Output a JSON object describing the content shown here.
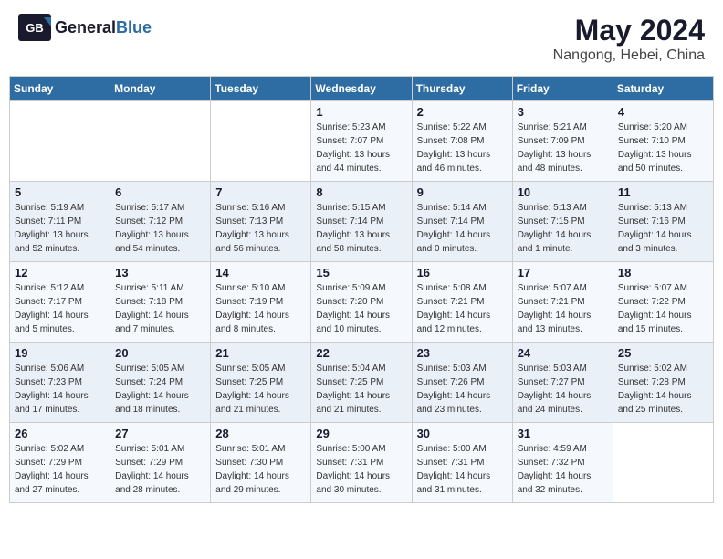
{
  "header": {
    "logo_general": "General",
    "logo_blue": "Blue",
    "month_year": "May 2024",
    "location": "Nangong, Hebei, China"
  },
  "weekdays": [
    "Sunday",
    "Monday",
    "Tuesday",
    "Wednesday",
    "Thursday",
    "Friday",
    "Saturday"
  ],
  "weeks": [
    [
      {
        "day": "",
        "sunrise": "",
        "sunset": "",
        "daylight": ""
      },
      {
        "day": "",
        "sunrise": "",
        "sunset": "",
        "daylight": ""
      },
      {
        "day": "",
        "sunrise": "",
        "sunset": "",
        "daylight": ""
      },
      {
        "day": "1",
        "sunrise": "Sunrise: 5:23 AM",
        "sunset": "Sunset: 7:07 PM",
        "daylight": "Daylight: 13 hours and 44 minutes."
      },
      {
        "day": "2",
        "sunrise": "Sunrise: 5:22 AM",
        "sunset": "Sunset: 7:08 PM",
        "daylight": "Daylight: 13 hours and 46 minutes."
      },
      {
        "day": "3",
        "sunrise": "Sunrise: 5:21 AM",
        "sunset": "Sunset: 7:09 PM",
        "daylight": "Daylight: 13 hours and 48 minutes."
      },
      {
        "day": "4",
        "sunrise": "Sunrise: 5:20 AM",
        "sunset": "Sunset: 7:10 PM",
        "daylight": "Daylight: 13 hours and 50 minutes."
      }
    ],
    [
      {
        "day": "5",
        "sunrise": "Sunrise: 5:19 AM",
        "sunset": "Sunset: 7:11 PM",
        "daylight": "Daylight: 13 hours and 52 minutes."
      },
      {
        "day": "6",
        "sunrise": "Sunrise: 5:17 AM",
        "sunset": "Sunset: 7:12 PM",
        "daylight": "Daylight: 13 hours and 54 minutes."
      },
      {
        "day": "7",
        "sunrise": "Sunrise: 5:16 AM",
        "sunset": "Sunset: 7:13 PM",
        "daylight": "Daylight: 13 hours and 56 minutes."
      },
      {
        "day": "8",
        "sunrise": "Sunrise: 5:15 AM",
        "sunset": "Sunset: 7:14 PM",
        "daylight": "Daylight: 13 hours and 58 minutes."
      },
      {
        "day": "9",
        "sunrise": "Sunrise: 5:14 AM",
        "sunset": "Sunset: 7:14 PM",
        "daylight": "Daylight: 14 hours and 0 minutes."
      },
      {
        "day": "10",
        "sunrise": "Sunrise: 5:13 AM",
        "sunset": "Sunset: 7:15 PM",
        "daylight": "Daylight: 14 hours and 1 minute."
      },
      {
        "day": "11",
        "sunrise": "Sunrise: 5:13 AM",
        "sunset": "Sunset: 7:16 PM",
        "daylight": "Daylight: 14 hours and 3 minutes."
      }
    ],
    [
      {
        "day": "12",
        "sunrise": "Sunrise: 5:12 AM",
        "sunset": "Sunset: 7:17 PM",
        "daylight": "Daylight: 14 hours and 5 minutes."
      },
      {
        "day": "13",
        "sunrise": "Sunrise: 5:11 AM",
        "sunset": "Sunset: 7:18 PM",
        "daylight": "Daylight: 14 hours and 7 minutes."
      },
      {
        "day": "14",
        "sunrise": "Sunrise: 5:10 AM",
        "sunset": "Sunset: 7:19 PM",
        "daylight": "Daylight: 14 hours and 8 minutes."
      },
      {
        "day": "15",
        "sunrise": "Sunrise: 5:09 AM",
        "sunset": "Sunset: 7:20 PM",
        "daylight": "Daylight: 14 hours and 10 minutes."
      },
      {
        "day": "16",
        "sunrise": "Sunrise: 5:08 AM",
        "sunset": "Sunset: 7:21 PM",
        "daylight": "Daylight: 14 hours and 12 minutes."
      },
      {
        "day": "17",
        "sunrise": "Sunrise: 5:07 AM",
        "sunset": "Sunset: 7:21 PM",
        "daylight": "Daylight: 14 hours and 13 minutes."
      },
      {
        "day": "18",
        "sunrise": "Sunrise: 5:07 AM",
        "sunset": "Sunset: 7:22 PM",
        "daylight": "Daylight: 14 hours and 15 minutes."
      }
    ],
    [
      {
        "day": "19",
        "sunrise": "Sunrise: 5:06 AM",
        "sunset": "Sunset: 7:23 PM",
        "daylight": "Daylight: 14 hours and 17 minutes."
      },
      {
        "day": "20",
        "sunrise": "Sunrise: 5:05 AM",
        "sunset": "Sunset: 7:24 PM",
        "daylight": "Daylight: 14 hours and 18 minutes."
      },
      {
        "day": "21",
        "sunrise": "Sunrise: 5:05 AM",
        "sunset": "Sunset: 7:25 PM",
        "daylight": "Daylight: 14 hours and 21 minutes."
      },
      {
        "day": "22",
        "sunrise": "Sunrise: 5:04 AM",
        "sunset": "Sunset: 7:25 PM",
        "daylight": "Daylight: 14 hours and 21 minutes."
      },
      {
        "day": "23",
        "sunrise": "Sunrise: 5:03 AM",
        "sunset": "Sunset: 7:26 PM",
        "daylight": "Daylight: 14 hours and 23 minutes."
      },
      {
        "day": "24",
        "sunrise": "Sunrise: 5:03 AM",
        "sunset": "Sunset: 7:27 PM",
        "daylight": "Daylight: 14 hours and 24 minutes."
      },
      {
        "day": "25",
        "sunrise": "Sunrise: 5:02 AM",
        "sunset": "Sunset: 7:28 PM",
        "daylight": "Daylight: 14 hours and 25 minutes."
      }
    ],
    [
      {
        "day": "26",
        "sunrise": "Sunrise: 5:02 AM",
        "sunset": "Sunset: 7:29 PM",
        "daylight": "Daylight: 14 hours and 27 minutes."
      },
      {
        "day": "27",
        "sunrise": "Sunrise: 5:01 AM",
        "sunset": "Sunset: 7:29 PM",
        "daylight": "Daylight: 14 hours and 28 minutes."
      },
      {
        "day": "28",
        "sunrise": "Sunrise: 5:01 AM",
        "sunset": "Sunset: 7:30 PM",
        "daylight": "Daylight: 14 hours and 29 minutes."
      },
      {
        "day": "29",
        "sunrise": "Sunrise: 5:00 AM",
        "sunset": "Sunset: 7:31 PM",
        "daylight": "Daylight: 14 hours and 30 minutes."
      },
      {
        "day": "30",
        "sunrise": "Sunrise: 5:00 AM",
        "sunset": "Sunset: 7:31 PM",
        "daylight": "Daylight: 14 hours and 31 minutes."
      },
      {
        "day": "31",
        "sunrise": "Sunrise: 4:59 AM",
        "sunset": "Sunset: 7:32 PM",
        "daylight": "Daylight: 14 hours and 32 minutes."
      },
      {
        "day": "",
        "sunrise": "",
        "sunset": "",
        "daylight": ""
      }
    ]
  ]
}
